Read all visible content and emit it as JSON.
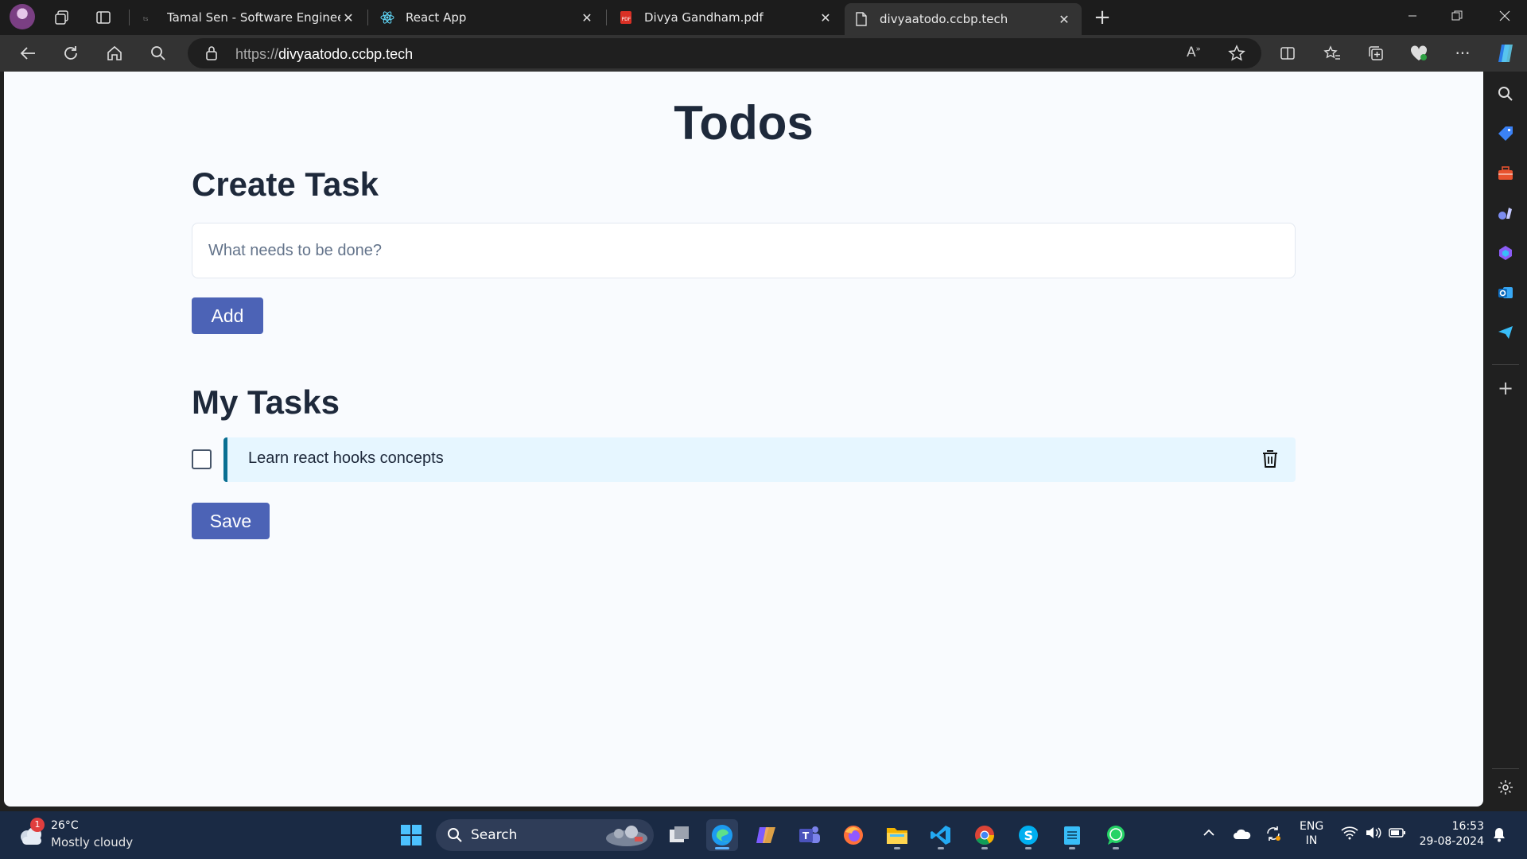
{
  "browser": {
    "tabs": [
      {
        "title": "Tamal Sen - Software Engineer, F",
        "favicon": "page-icon",
        "active": false
      },
      {
        "title": "React App",
        "favicon": "react-icon",
        "active": false
      },
      {
        "title": "Divya Gandham.pdf",
        "favicon": "pdf-icon",
        "active": false
      },
      {
        "title": "divyaatodo.ccbp.tech",
        "favicon": "document-icon",
        "active": true
      }
    ],
    "url_scheme": "https://",
    "url_host": "divyaatodo.ccbp.tech"
  },
  "page": {
    "title": "Todos",
    "create_heading_bold": "Create",
    "create_heading_rest": " Task",
    "input_placeholder": "What needs to be done?",
    "add_label": "Add",
    "tasks_heading_bold": "My",
    "tasks_heading_rest": " Tasks",
    "tasks": [
      {
        "label": "Learn react hooks concepts",
        "checked": false
      }
    ],
    "save_label": "Save"
  },
  "taskbar": {
    "weather_temp": "26°C",
    "weather_desc": "Mostly cloudy",
    "weather_badge": "1",
    "search_label": "Search",
    "lang_top": "ENG",
    "lang_bottom": "IN",
    "time": "16:53",
    "date": "29-08-2024"
  },
  "colors": {
    "accent": "#4c63b6",
    "task_bg": "#e6f6ff",
    "task_border": "#096f92",
    "page_bg": "#f9fbfe"
  }
}
